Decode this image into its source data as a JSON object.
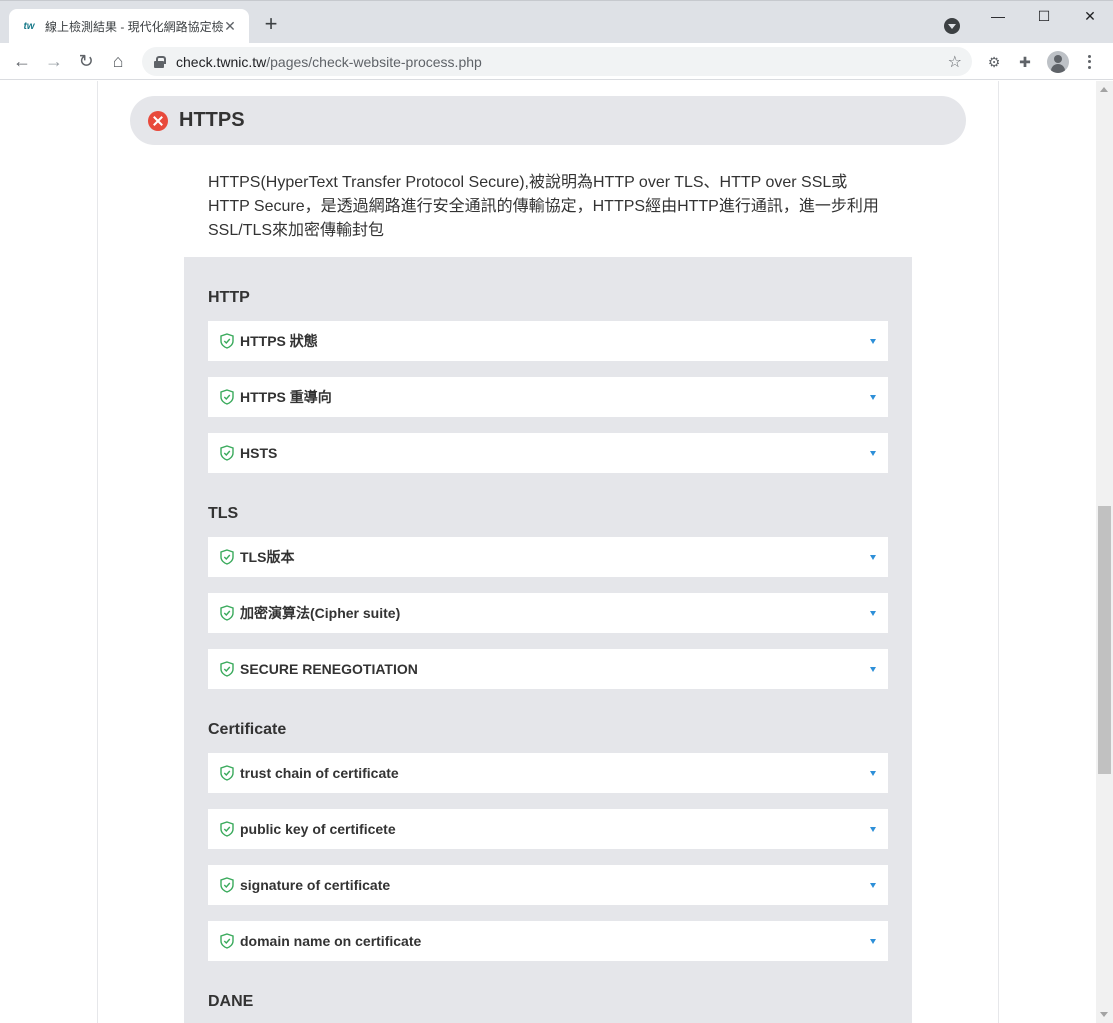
{
  "browser": {
    "tab_title": "線上檢測結果 - 現代化網路協定檢",
    "tab_favicon_text": "tw",
    "url_host": "check.twnic.tw",
    "url_path": "/pages/check-website-process.php"
  },
  "section": {
    "title": "HTTPS",
    "status": "fail",
    "description": "HTTPS(HyperText Transfer Protocol Secure),被說明為HTTP over TLS、HTTP over SSL或HTTP Secure，是透過網路進行安全通訊的傳輸協定，HTTPS經由HTTP進行通訊，進一步利用SSL/TLS來加密傳輸封包"
  },
  "groups": [
    {
      "title": "HTTP",
      "items": [
        "HTTPS 狀態",
        "HTTPS 重導向",
        "HSTS"
      ]
    },
    {
      "title": "TLS",
      "items": [
        "TLS版本",
        "加密演算法(Cipher suite)",
        "SECURE RENEGOTIATION"
      ]
    },
    {
      "title": "Certificate",
      "items": [
        "trust chain of certificate",
        "public key of certificete",
        "signature of certificate",
        "domain name on certificate"
      ]
    },
    {
      "title": "DANE",
      "items": []
    }
  ],
  "colors": {
    "fail_red": "#e84a3c",
    "pass_green": "#3aaa5c",
    "caret_blue": "#2d8fd8",
    "panel_gray": "#e5e6ea"
  }
}
